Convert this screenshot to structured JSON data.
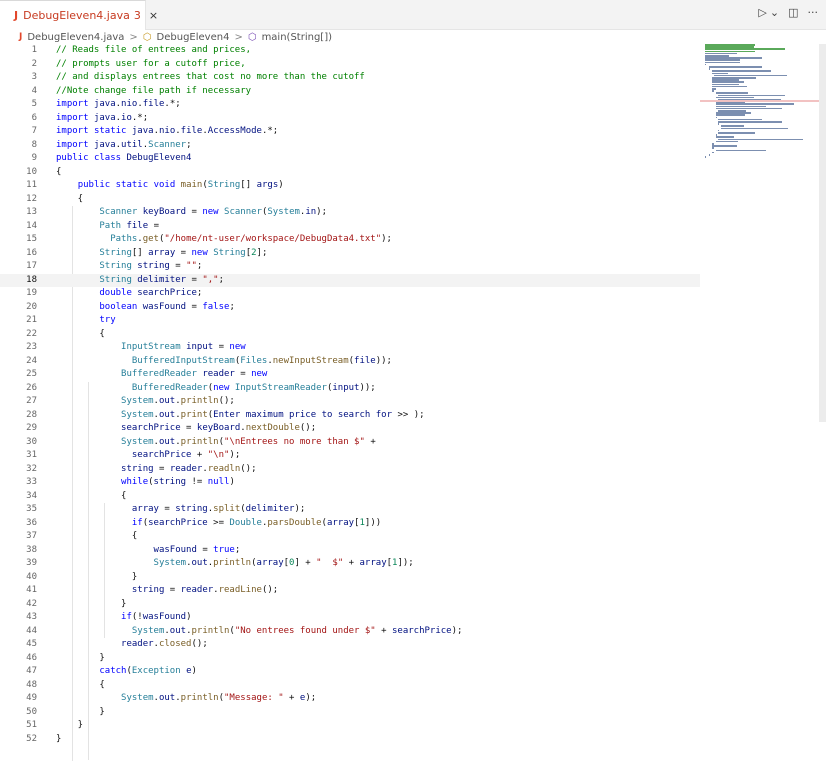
{
  "tab": {
    "file": "DebugEleven4.java",
    "problems": "3",
    "close": "×",
    "icon": "J"
  },
  "topbar": {
    "run": "▷",
    "run_dropdown": "⌄",
    "split": "◫",
    "more": "···"
  },
  "breadcrumb": {
    "icon": "J",
    "file": "DebugEleven4.java",
    "sep1": ">",
    "class_icon": "⬡",
    "class": "DebugEleven4",
    "sep2": ">",
    "method_icon": "⬡",
    "method": "main(String[])"
  },
  "editor": {
    "current_line": 18,
    "lines": [
      "// Reads file of entrees and prices,",
      "// prompts user for a cutoff price,",
      "// and displays entrees that cost no more than the cutoff",
      "//Note change file path if necessary",
      "import java.nio.file.*;",
      "import java.io.*;",
      "import static java.nio.file.AccessMode.*;",
      "import java.util.Scanner;",
      "public class DebugEleven4",
      "{",
      "    public static void main(String[] args)",
      "    {",
      "        Scanner keyBoard = new Scanner(System.in);",
      "        Path file =",
      "          Paths.get(\"/home/nt-user/workspace/DebugData4.txt\");",
      "        String[] array = new String[2];",
      "        String string = \"\";",
      "        String delimiter = \",\";",
      "        double searchPrice;",
      "        boolean wasFound = false;",
      "        try",
      "        {",
      "            InputStream input = new",
      "              BufferedInputStream(Files.newInputStream(file));",
      "            BufferedReader reader = new",
      "              BufferedReader(new InputStreamReader(input));",
      "            System.out.println();",
      "            System.out.print(Enter maximum price to search for >> );",
      "            searchPrice = keyBoard.nextDouble();",
      "            System.out.println(\"\\nEntrees no more than $\" +",
      "              searchPrice + \"\\n\");",
      "            string = reader.readln();",
      "            while(string != null)",
      "            {",
      "              array = string.split(delimiter);",
      "              if(searchPrice >= Double.parsDouble(array[1]))",
      "              {",
      "                  wasFound = true;",
      "                  System.out.println(array[0] + \"  $\" + array[1]);",
      "              }",
      "              string = reader.readLine();",
      "            }",
      "            if(!wasFound)",
      "              System.out.println(\"No entrees found under $\" + searchPrice);",
      "            reader.closed();",
      "        }",
      "        catch(Exception e)",
      "        {",
      "            System.out.println(\"Message: \" + e);",
      "        }",
      "    }",
      "}"
    ]
  },
  "colors": {
    "keyword": "#0000ff",
    "comment": "#008000",
    "string": "#a31515",
    "type": "#267f99",
    "method": "#795e26",
    "variable": "#001080",
    "accent": "#e2472b"
  }
}
